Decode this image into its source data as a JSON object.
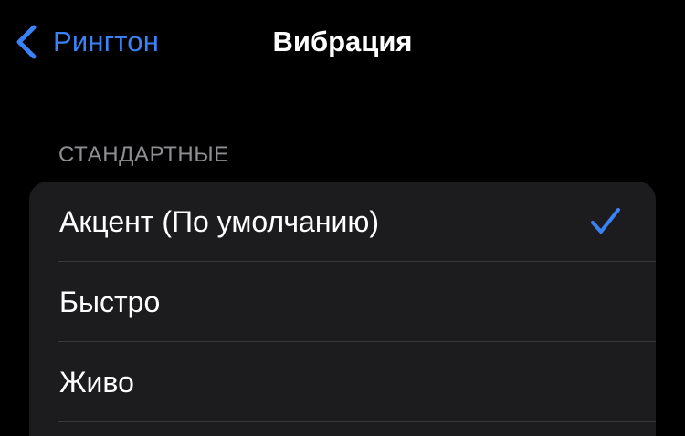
{
  "navbar": {
    "back_label": "Рингтон",
    "title": "Вибрация"
  },
  "section": {
    "header": "СТАНДАРТНЫЕ",
    "items": [
      {
        "label": "Акцент (По умолчанию)",
        "selected": true
      },
      {
        "label": "Быстро",
        "selected": false
      },
      {
        "label": "Живо",
        "selected": false
      }
    ]
  },
  "colors": {
    "accent": "#3b82f6",
    "background": "#000000",
    "cell": "#1c1c1e",
    "secondary_text": "#8e8e93"
  }
}
